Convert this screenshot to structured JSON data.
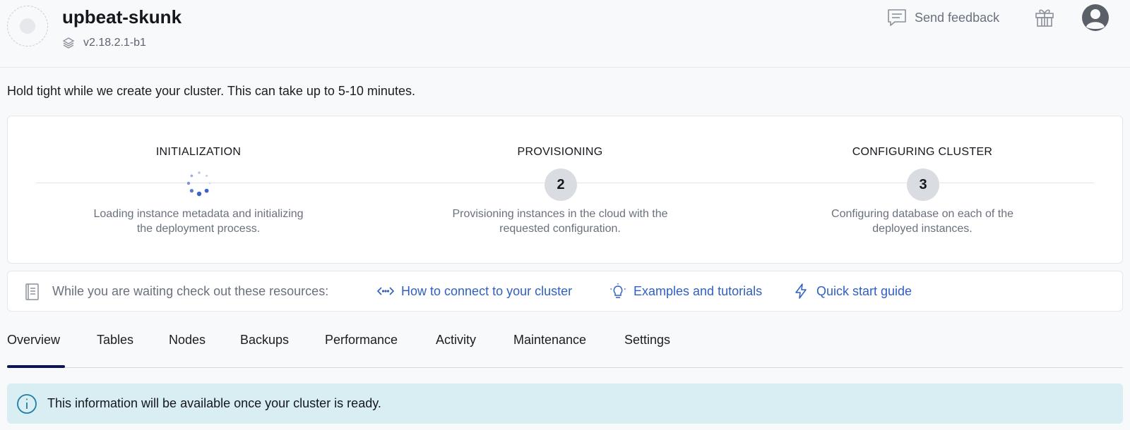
{
  "header": {
    "cluster_name": "upbeat-skunk",
    "version": "v2.18.2.1-b1",
    "feedback_label": "Send feedback"
  },
  "status_message": "Hold tight while we create your cluster. This can take up to 5-10 minutes.",
  "steps": [
    {
      "title": "INITIALIZATION",
      "number": "",
      "state": "in-progress",
      "desc_line1": "Loading instance metadata and initializing",
      "desc_line2": "the deployment process."
    },
    {
      "title": "PROVISIONING",
      "number": "2",
      "state": "pending",
      "desc_line1": "Provisioning instances in the cloud with the",
      "desc_line2": "requested configuration."
    },
    {
      "title": "CONFIGURING CLUSTER",
      "number": "3",
      "state": "pending",
      "desc_line1": "Configuring database on each of the",
      "desc_line2": "deployed instances."
    }
  ],
  "resources": {
    "lead": "While you are waiting check out these resources:",
    "links": [
      {
        "label": "How to connect to your cluster",
        "icon": "code-arrows-icon"
      },
      {
        "label": "Examples and tutorials",
        "icon": "lightbulb-icon"
      },
      {
        "label": "Quick start guide",
        "icon": "lightning-icon"
      }
    ]
  },
  "tabs": [
    "Overview",
    "Tables",
    "Nodes",
    "Backups",
    "Performance",
    "Activity",
    "Maintenance",
    "Settings"
  ],
  "active_tab": "Overview",
  "info_banner": "This information will be available once your cluster is ready.",
  "colors": {
    "link": "#2f5fc4",
    "active_tab_underline": "#0f1452",
    "info_bg": "#d8eef2",
    "info_icon": "#1f7fa6",
    "spinner": "#3d62c8"
  }
}
